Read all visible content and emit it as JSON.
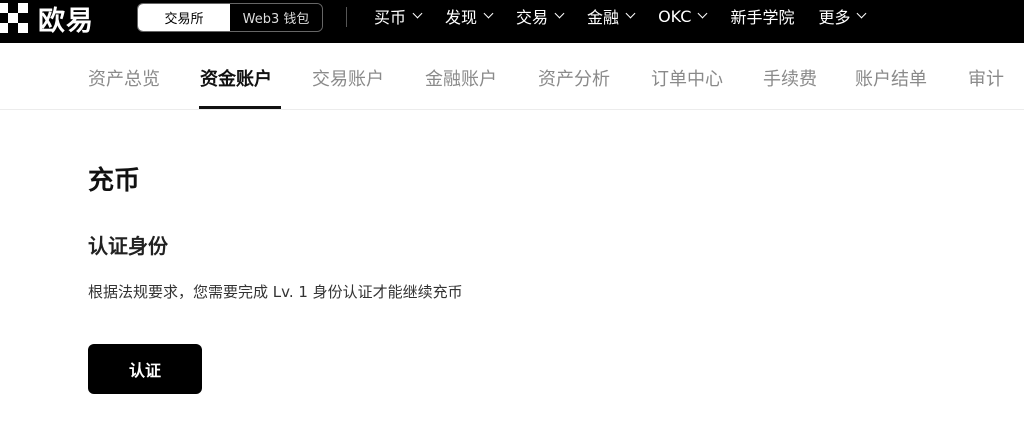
{
  "brand": {
    "logo_text": "欧易"
  },
  "mode_switch": {
    "options": [
      "交易所",
      "Web3 钱包"
    ],
    "selected": "交易所"
  },
  "top_nav": {
    "items": [
      {
        "label": "买币",
        "dropdown": true
      },
      {
        "label": "发现",
        "dropdown": true
      },
      {
        "label": "交易",
        "dropdown": true
      },
      {
        "label": "金融",
        "dropdown": true
      },
      {
        "label": "OKC",
        "dropdown": true
      },
      {
        "label": "新手学院",
        "dropdown": false
      },
      {
        "label": "更多",
        "dropdown": true
      }
    ]
  },
  "sub_nav": {
    "items": [
      "资产总览",
      "资金账户",
      "交易账户",
      "金融账户",
      "资产分析",
      "订单中心",
      "手续费",
      "账户结单",
      "审计"
    ],
    "active": "资金账户"
  },
  "page": {
    "title": "充币",
    "section_title": "认证身份",
    "description": "根据法规要求，您需要完成 Lv. 1 身份认证才能继续充币",
    "verify_button": "认证"
  },
  "colors": {
    "topbar_bg": "#000000",
    "button_bg": "#000000",
    "active_tab": "#111111",
    "inactive_tab": "#8a8a8a"
  }
}
